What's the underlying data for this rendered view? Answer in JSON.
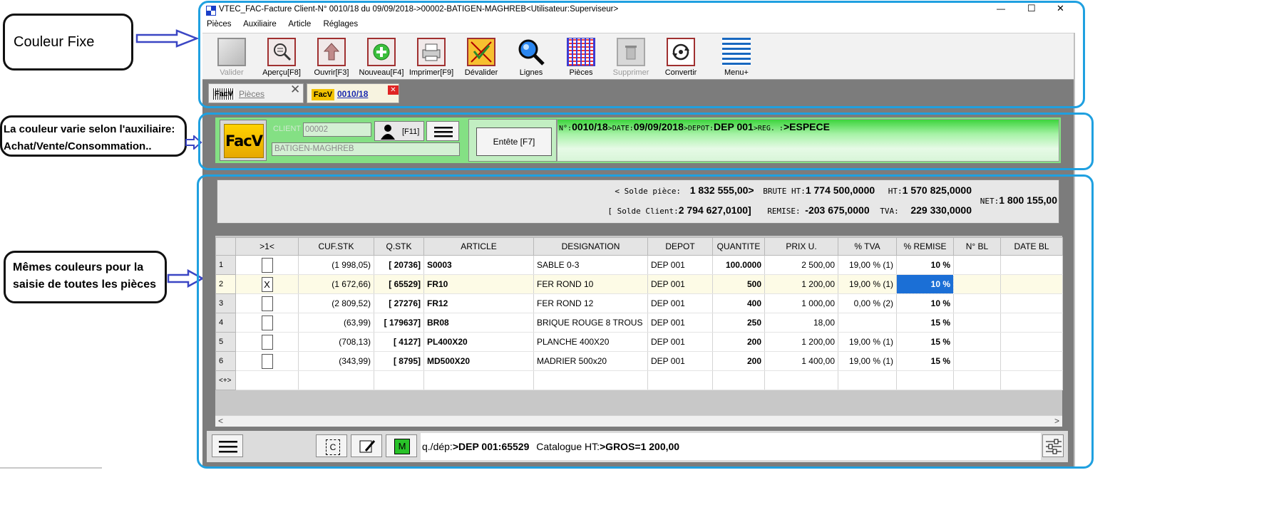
{
  "callouts": {
    "fixed": "Couleur Fixe",
    "variable_line1": "La couleur varie selon l'auxiliaire:",
    "variable_line2": "Achat/Vente/Consommation..",
    "same_line1": "Mêmes couleurs pour la",
    "same_line2": "saisie de toutes les pièces"
  },
  "window": {
    "title": "VTEC_FAC-Facture Client-N° 0010/18 du 09/09/2018->00002-BATIGEN-MAGHREB<Utilisateur:Superviseur>",
    "controls": {
      "minimize": "—",
      "maximize": "☐",
      "close": "✕"
    }
  },
  "menu": [
    "Pièces",
    "Auxiliaire",
    "Article",
    "Réglages"
  ],
  "toolbar": [
    {
      "label": "Valider",
      "icon": "validate-icon",
      "disabled": true
    },
    {
      "label": "Aperçu[F8]",
      "icon": "preview-icon"
    },
    {
      "label": "Ouvrir[F3]",
      "icon": "open-icon"
    },
    {
      "label": "Nouveau[F4]",
      "icon": "new-icon"
    },
    {
      "label": "Imprimer[F9]",
      "icon": "print-icon"
    },
    {
      "label": "Dévalider",
      "icon": "invalidate-icon"
    },
    {
      "label": "Lignes",
      "icon": "search-lines-icon"
    },
    {
      "label": "Pièces",
      "icon": "pieces-icon"
    },
    {
      "label": "Supprimer",
      "icon": "delete-icon",
      "disabled": true
    },
    {
      "label": "Convertir",
      "icon": "convert-icon"
    },
    {
      "label": "Menu+",
      "icon": "menu-plus-icon"
    }
  ],
  "tabs": {
    "pieces_badge": "FacV",
    "pieces_label": "Pièces",
    "doc_badge": "FacV",
    "doc_label": "0010/18"
  },
  "header": {
    "logo": "FacV",
    "client_label": "CLIENT",
    "client_code": "00002",
    "client_key": "[F11]",
    "client_name": "BATIGEN-MAGHREB",
    "entete_button": "Entête [F7]",
    "info": {
      "no_label": "N°:",
      "no_value": "0010/18",
      "date_label": ">DATE:",
      "date_value": "09/09/2018",
      "depot_label": ">DEPOT:",
      "depot_value": "DEP 001",
      "reg_label": ">REG. :",
      "reg_value": ">ESPECE"
    }
  },
  "summary": {
    "solde_piece_label": "< Solde pièce:",
    "solde_piece_value": "1 832 555,00>",
    "brute_label": "BRUTE HT:",
    "brute_value": "1 774 500,0000",
    "ht_label": "HT:",
    "ht_value": "1 570 825,0000",
    "net_label": "NET:",
    "net_value": "1 800 155,00",
    "solde_client_label": "[ Solde Client:",
    "solde_client_value": "2 794 627,0100]",
    "remise_label": "REMISE:",
    "remise_value": "-203 675,0000",
    "tva_label": "TVA:",
    "tva_value": "229 330,0000"
  },
  "grid": {
    "columns": [
      ">1<",
      "CUF.STK",
      "Q.STK",
      "ARTICLE",
      "DESIGNATION",
      "DEPOT",
      "QUANTITE",
      "PRIX U.",
      "% TVA",
      "% REMISE",
      "N° BL",
      "DATE BL"
    ],
    "rows": [
      {
        "n": "1",
        "check": "",
        "cuf": "(1 998,05)",
        "qstk": "[ 20736]",
        "article": "S0003",
        "designation": "SABLE 0-3",
        "depot": "DEP 001",
        "quantite": "100.0000",
        "prix": "2 500,00",
        "tva": "19,00 % (1)",
        "remise": "10 %",
        "bl": "",
        "date_bl": ""
      },
      {
        "n": "2",
        "check": "X",
        "cuf": "(1 672,66)",
        "qstk": "[ 65529]",
        "article": "FR10",
        "designation": "FER ROND 10",
        "depot": "DEP 001",
        "quantite": "500",
        "prix": "1 200,00",
        "tva": "19,00 % (1)",
        "remise": "10 %",
        "bl": "",
        "date_bl": ""
      },
      {
        "n": "3",
        "check": "",
        "cuf": "(2 809,52)",
        "qstk": "[ 27276]",
        "article": "FR12",
        "designation": "FER ROND 12",
        "depot": "DEP 001",
        "quantite": "400",
        "prix": "1 000,00",
        "tva": "0,00 % (2)",
        "remise": "10 %",
        "bl": "",
        "date_bl": ""
      },
      {
        "n": "4",
        "check": "",
        "cuf": "(63,99)",
        "qstk": "[ 179637]",
        "article": "BR08",
        "designation": "BRIQUE ROUGE 8 TROUS",
        "depot": "DEP 001",
        "quantite": "250",
        "prix": "18,00",
        "tva": "",
        "remise": "15 %",
        "bl": "",
        "date_bl": ""
      },
      {
        "n": "5",
        "check": "",
        "cuf": "(708,13)",
        "qstk": "[ 4127]",
        "article": "PL400X20",
        "designation": "PLANCHE 400X20",
        "depot": "DEP 001",
        "quantite": "200",
        "prix": "1 200,00",
        "tva": "19,00 % (1)",
        "remise": "15 %",
        "bl": "",
        "date_bl": ""
      },
      {
        "n": "6",
        "check": "",
        "cuf": "(343,99)",
        "qstk": "[ 8795]",
        "article": "MD500X20",
        "designation": "MADRIER 500x20",
        "depot": "DEP 001",
        "quantite": "200",
        "prix": "1 400,00",
        "tva": "19,00 % (1)",
        "remise": "15 %",
        "bl": "",
        "date_bl": ""
      }
    ],
    "new_row_marker": "<+>"
  },
  "scrollbar": {
    "left": "<",
    "right": ">"
  },
  "status": {
    "btn_c": "C",
    "btn_m": "M",
    "qdep_label": "q./dép:",
    "qdep_value": ">DEP 001:65529",
    "catalogue_label": "Catalogue HT:",
    "catalogue_value": ">GROS=1 200,00"
  },
  "colors": {
    "frame_blue": "#1fa0e0",
    "header_green": "#84e084",
    "logo_yellow": "#f2c200",
    "selected_cell": "#1b6fd6"
  }
}
